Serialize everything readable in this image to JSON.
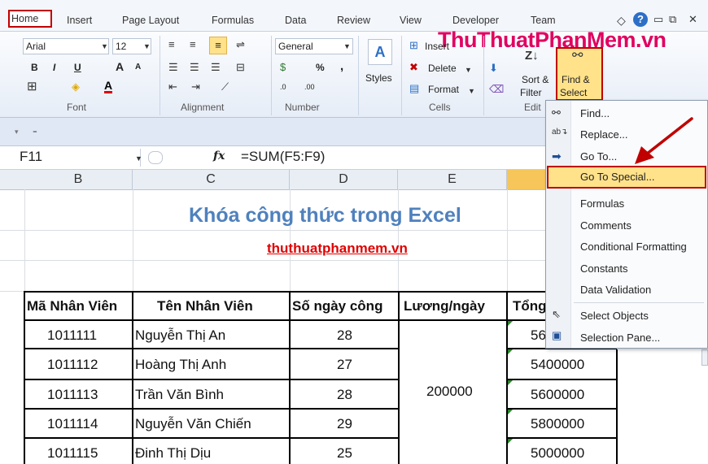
{
  "tabs": [
    {
      "label": "Home"
    },
    {
      "label": "Insert"
    },
    {
      "label": "Page Layout"
    },
    {
      "label": "Formulas"
    },
    {
      "label": "Data"
    },
    {
      "label": "Review"
    },
    {
      "label": "View"
    },
    {
      "label": "Developer"
    },
    {
      "label": "Team"
    }
  ],
  "watermark": "ThuThuatPhanMem.vn",
  "font": {
    "name": "Arial",
    "size": "12",
    "bold": "B",
    "italic": "I",
    "underline": "U",
    "grow": "A",
    "shrink": "A",
    "color": "A",
    "group_label": "Font"
  },
  "alignment": {
    "group_label": "Alignment"
  },
  "number": {
    "format": "General",
    "percent": "%",
    "comma": ",",
    "inc_decimal": ".0",
    "dec_decimal": ".00",
    "group_label": "Number"
  },
  "styles": {
    "label": "Styles"
  },
  "cells": {
    "insert": "Insert",
    "delete": "Delete",
    "format": "Format",
    "group_label": "Cells"
  },
  "editing": {
    "sort_filter_1": "Sort &",
    "sort_filter_2": "Filter",
    "find_select_1": "Find &",
    "find_select_2": "Select",
    "group_label": "Edit"
  },
  "formula_bar": {
    "name_box": "F11",
    "fx": "fx",
    "formula": "=SUM(F5:F9)"
  },
  "columns": [
    "B",
    "C",
    "D",
    "E"
  ],
  "sheet": {
    "title": "Khóa công thức trong Excel",
    "subtitle": "thuthuatphanmem.vn",
    "headers": [
      "Mã Nhân Viên",
      "Tên Nhân Viên",
      "Số ngày công",
      "Lương/ngày",
      "Tổng"
    ],
    "rows": [
      {
        "id": "1011111",
        "name": "Nguyễn Thị An",
        "days": "28",
        "total": "56"
      },
      {
        "id": "1011112",
        "name": "Hoàng Thị Anh",
        "days": "27",
        "total": "5400000"
      },
      {
        "id": "1011113",
        "name": "Trần Văn Bình",
        "days": "28",
        "total": "5600000"
      },
      {
        "id": "1011114",
        "name": "Nguyễn Văn Chiến",
        "days": "29",
        "total": "5800000"
      },
      {
        "id": "1011115",
        "name": "Đinh Thị Dịu",
        "days": "25",
        "total": "5000000"
      }
    ],
    "salary": "200000"
  },
  "menu": {
    "items": [
      {
        "label": "Find..."
      },
      {
        "label": "Replace..."
      },
      {
        "label": "Go To..."
      },
      {
        "label": "Go To Special..."
      },
      {
        "label": "Formulas"
      },
      {
        "label": "Comments"
      },
      {
        "label": "Conditional Formatting"
      },
      {
        "label": "Constants"
      },
      {
        "label": "Data Validation"
      },
      {
        "label": "Select Objects"
      },
      {
        "label": "Selection Pane..."
      }
    ]
  },
  "colors": {
    "accent_red": "#c00000",
    "title_blue": "#4f81bd",
    "highlight": "#ffe28a",
    "ribbon": "#e6edf7"
  }
}
